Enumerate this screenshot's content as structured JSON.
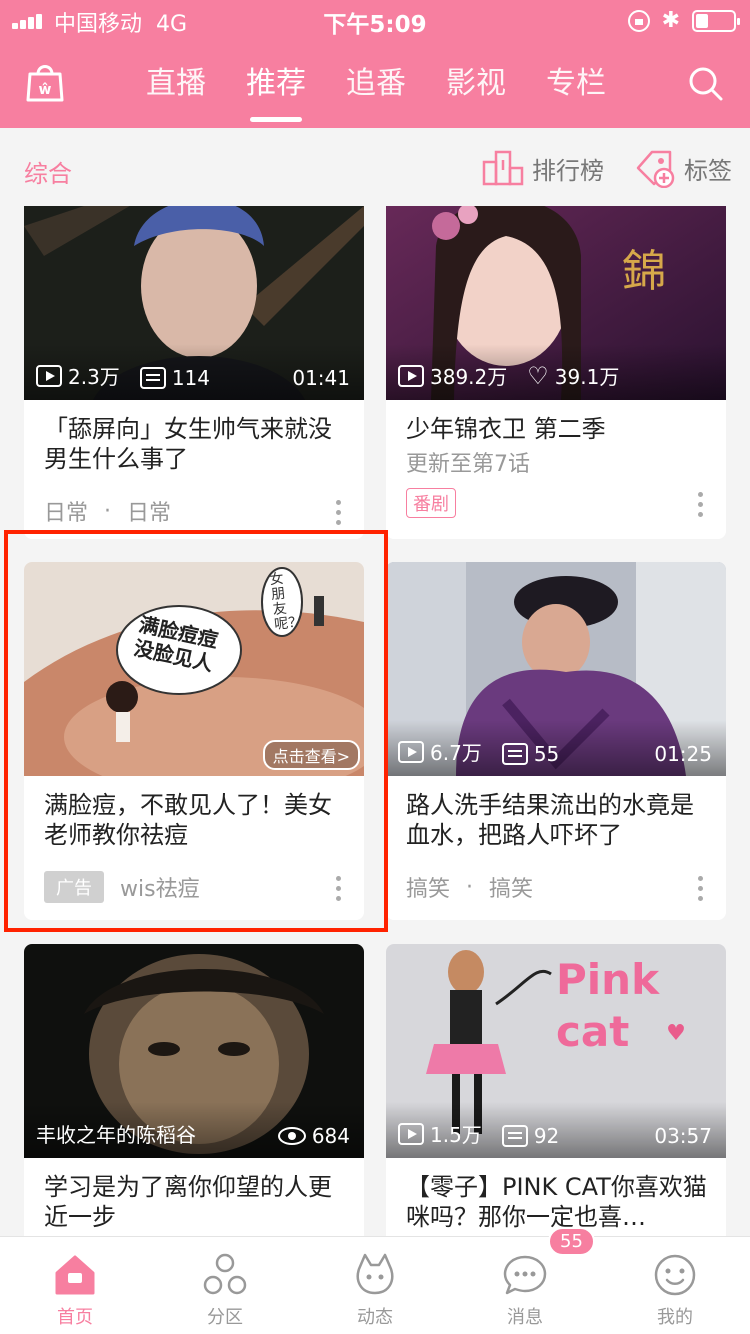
{
  "colors": {
    "accent": "#f77fa0",
    "ad_highlight": "#ff2200"
  },
  "status_bar": {
    "carrier": "中国移动",
    "network": "4G",
    "time": "下午5:09"
  },
  "header": {
    "tabs": [
      {
        "label": "直播",
        "active": false
      },
      {
        "label": "推荐",
        "active": true
      },
      {
        "label": "追番",
        "active": false
      },
      {
        "label": "影视",
        "active": false
      },
      {
        "label": "专栏",
        "active": false
      }
    ],
    "logo_icon": "shopping-bag-icon",
    "search_icon": "search-icon"
  },
  "subbar": {
    "left_label": "综合",
    "rank_label": "排行榜",
    "tag_label": "标签"
  },
  "cards": [
    {
      "title": "「舔屏向」女生帅气来就没男生什么事了",
      "views": "2.3万",
      "danmaku": "114",
      "duration": "01:41",
      "tag1": "日常",
      "tag2": "日常"
    },
    {
      "title": "少年锦衣卫 第二季",
      "subtitle": "更新至第7话",
      "views": "389.2万",
      "likes": "39.1万",
      "badge": "番剧"
    },
    {
      "title": "满脸痘，不敢见人了！美女老师教你祛痘",
      "ad_badge": "广告",
      "advertiser": "wis祛痘",
      "ad_cta": "点击查看>",
      "img_text_1": "满脸痘痘",
      "img_text_2": "没脸见人",
      "img_bubble": "女朋友呢？"
    },
    {
      "title": "路人洗手结果流出的水竟是血水，把路人吓坏了",
      "views": "6.7万",
      "danmaku": "55",
      "duration": "01:25",
      "tag1": "搞笑",
      "tag2": "搞笑"
    },
    {
      "title": "学习是为了离你仰望的人更近一步",
      "caption": "丰收之年的陈稻谷",
      "views": "684"
    },
    {
      "title": "【零子】PINK CAT你喜欢猫咪吗？那你一定也喜…",
      "views": "1.5万",
      "danmaku": "92",
      "duration": "03:57",
      "img_text": "Pink cat"
    }
  ],
  "bottom_nav": [
    {
      "label": "首页",
      "icon": "home-icon",
      "active": true
    },
    {
      "label": "分区",
      "icon": "category-icon",
      "active": false
    },
    {
      "label": "动态",
      "icon": "moments-icon",
      "active": false
    },
    {
      "label": "消息",
      "icon": "message-icon",
      "active": false,
      "badge": "55"
    },
    {
      "label": "我的",
      "icon": "profile-icon",
      "active": false
    }
  ]
}
